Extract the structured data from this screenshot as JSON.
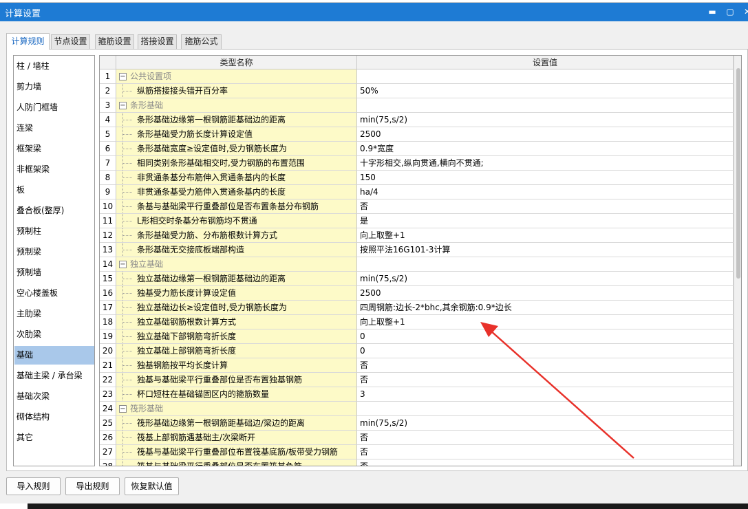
{
  "window": {
    "title": "计算设置"
  },
  "tabs": [
    {
      "label": "计算规则",
      "active": true
    },
    {
      "label": "节点设置",
      "active": false
    },
    {
      "label": "箍筋设置",
      "active": false
    },
    {
      "label": "搭接设置",
      "active": false
    },
    {
      "label": "箍筋公式",
      "active": false
    }
  ],
  "sidebar": {
    "items": [
      {
        "label": "柱 / 墙柱"
      },
      {
        "label": "剪力墙"
      },
      {
        "label": "人防门框墙"
      },
      {
        "label": "连梁"
      },
      {
        "label": "框架梁"
      },
      {
        "label": "非框架梁"
      },
      {
        "label": "板"
      },
      {
        "label": "叠合板(整厚)"
      },
      {
        "label": "预制柱"
      },
      {
        "label": "预制梁"
      },
      {
        "label": "预制墙"
      },
      {
        "label": "空心楼盖板"
      },
      {
        "label": "主肋梁"
      },
      {
        "label": "次肋梁"
      },
      {
        "label": "基础",
        "selected": true
      },
      {
        "label": "基础主梁 / 承台梁"
      },
      {
        "label": "基础次梁"
      },
      {
        "label": "砌体结构"
      },
      {
        "label": "其它"
      }
    ],
    "selected_index": 14
  },
  "grid": {
    "headers": {
      "name": "类型名称",
      "value": "设置值"
    },
    "rows": [
      {
        "num": "1",
        "type": "group",
        "name": "公共设置项",
        "value": ""
      },
      {
        "num": "2",
        "type": "child",
        "name": "纵筋搭接接头错开百分率",
        "value": "50%"
      },
      {
        "num": "3",
        "type": "group",
        "name": "条形基础",
        "value": ""
      },
      {
        "num": "4",
        "type": "child",
        "name": "条形基础边缘第一根钢筋距基础边的距离",
        "value": "min(75,s/2)"
      },
      {
        "num": "5",
        "type": "child",
        "name": "条形基础受力筋长度计算设定值",
        "value": "2500"
      },
      {
        "num": "6",
        "type": "child",
        "name": "条形基础宽度≥设定值时,受力钢筋长度为",
        "value": "0.9*宽度"
      },
      {
        "num": "7",
        "type": "child",
        "name": "相同类别条形基础相交时,受力钢筋的布置范围",
        "value": "十字形相交,纵向贯通,横向不贯通;"
      },
      {
        "num": "8",
        "type": "child",
        "name": "非贯通条基分布筋伸入贯通条基内的长度",
        "value": "150"
      },
      {
        "num": "9",
        "type": "child",
        "name": "非贯通条基受力筋伸入贯通条基内的长度",
        "value": "ha/4"
      },
      {
        "num": "10",
        "type": "child",
        "name": "条基与基础梁平行重叠部位是否布置条基分布钢筋",
        "value": "否"
      },
      {
        "num": "11",
        "type": "child",
        "name": "L形相交时条基分布钢筋均不贯通",
        "value": "是"
      },
      {
        "num": "12",
        "type": "child",
        "name": "条形基础受力筋、分布筋根数计算方式",
        "value": "向上取整+1"
      },
      {
        "num": "13",
        "type": "child",
        "name": "条形基础无交接底板端部构造",
        "value": "按照平法16G101-3计算"
      },
      {
        "num": "14",
        "type": "group",
        "name": "独立基础",
        "value": ""
      },
      {
        "num": "15",
        "type": "child",
        "name": "独立基础边缘第一根钢筋距基础边的距离",
        "value": "min(75,s/2)"
      },
      {
        "num": "16",
        "type": "child",
        "name": "独基受力筋长度计算设定值",
        "value": "2500"
      },
      {
        "num": "17",
        "type": "child",
        "name": "独立基础边长≥设定值时,受力钢筋长度为",
        "value": "四周钢筋:边长-2*bhc,其余钢筋:0.9*边长"
      },
      {
        "num": "18",
        "type": "child",
        "name": "独立基础钢筋根数计算方式",
        "value": "向上取整+1"
      },
      {
        "num": "19",
        "type": "child",
        "name": "独立基础下部钢筋弯折长度",
        "value": "0"
      },
      {
        "num": "20",
        "type": "child",
        "name": "独立基础上部钢筋弯折长度",
        "value": "0"
      },
      {
        "num": "21",
        "type": "child",
        "name": "独基钢筋按平均长度计算",
        "value": "否"
      },
      {
        "num": "22",
        "type": "child",
        "name": "独基与基础梁平行重叠部位是否布置独基钢筋",
        "value": "否"
      },
      {
        "num": "23",
        "type": "child",
        "name": "杯口短柱在基础锚固区内的箍筋数量",
        "value": "3"
      },
      {
        "num": "24",
        "type": "group",
        "name": "筏形基础",
        "value": ""
      },
      {
        "num": "25",
        "type": "child",
        "name": "筏形基础边缘第一根钢筋距基础边/梁边的距离",
        "value": "min(75,s/2)"
      },
      {
        "num": "26",
        "type": "child",
        "name": "筏基上部钢筋遇基础主/次梁断开",
        "value": "否"
      },
      {
        "num": "27",
        "type": "child",
        "name": "筏基与基础梁平行重叠部位布置筏基底筋/板带受力钢筋",
        "value": "否"
      },
      {
        "num": "28",
        "type": "child",
        "name": "筏基与基础梁平行重叠部位是否布置筏基负筋",
        "value": "否"
      }
    ]
  },
  "buttons": {
    "import": "导入规则",
    "export": "导出规则",
    "restore": "恢复默认值"
  },
  "colors": {
    "titlebar": "#1e7bd4",
    "name_cell_bg": "#fdfac8",
    "selected_item": "#a9c8ea",
    "annotation_arrow": "#e8312a"
  }
}
